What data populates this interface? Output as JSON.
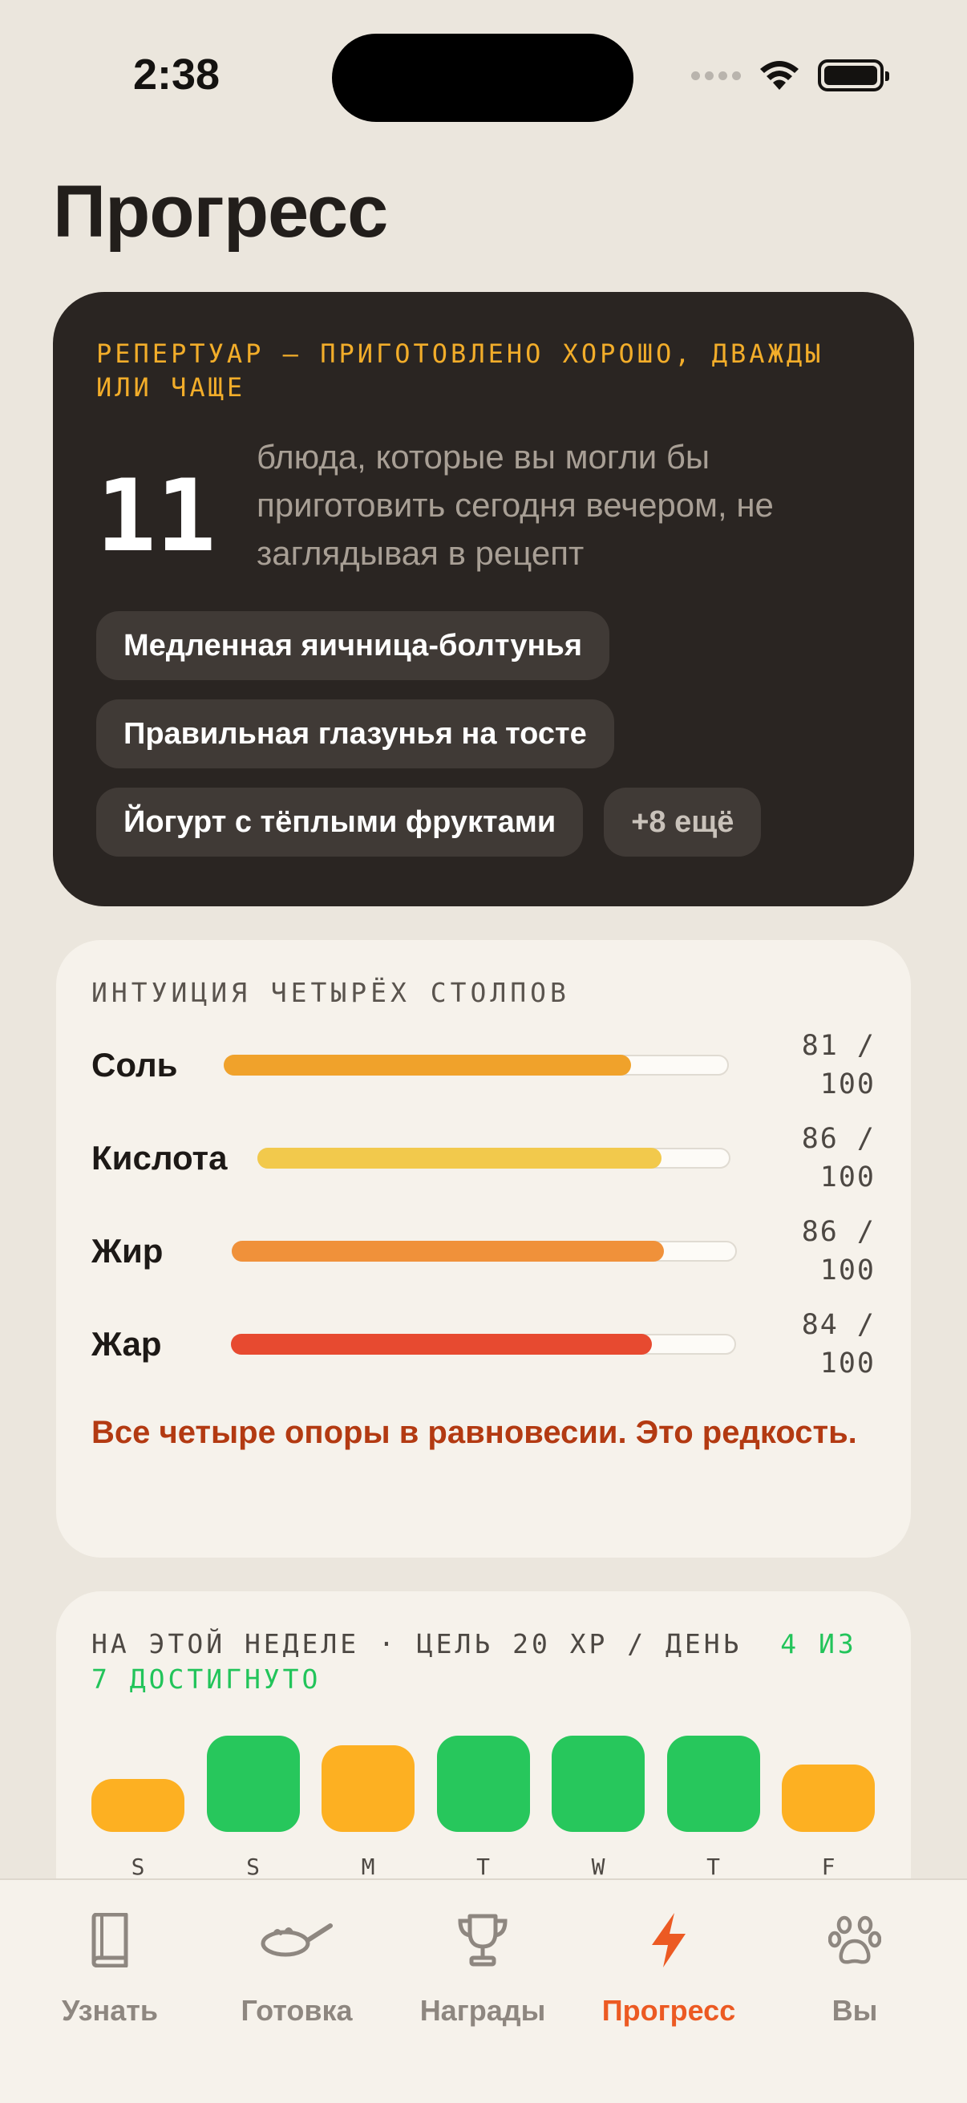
{
  "status_bar": {
    "time": "2:38"
  },
  "header": {
    "title": "Прогресс"
  },
  "repertoire": {
    "label": "РЕПЕРТУАР — ПРИГОТОВЛЕНО ХОРОШО, ДВАЖДЫ ИЛИ ЧАЩЕ",
    "count": "11",
    "description": "блюда, которые вы могли бы приготовить сегодня вечером, не заглядывая в рецепт",
    "dishes": [
      "Медленная яичница-болтунья",
      "Правильная глазунья на тосте",
      "Йогурт с тёплыми фруктами"
    ],
    "more": "+8 ещё"
  },
  "pillars": {
    "label": "ИНТУИЦИЯ ЧЕТЫРЁХ СТОЛПОВ",
    "items": [
      {
        "name": "Соль",
        "score_text": "81 / 100",
        "value": 81,
        "color": "#f0a22b"
      },
      {
        "name": "Кислота",
        "score_text": "86 / 100",
        "value": 86,
        "color": "#f2c94c"
      },
      {
        "name": "Жир",
        "score_text": "86 / 100",
        "value": 86,
        "color": "#f0913a"
      },
      {
        "name": "Жар",
        "score_text": "84 / 100",
        "value": 84,
        "color": "#e74a30"
      }
    ],
    "message": "Все четыре опоры в равновесии. Это редкость."
  },
  "week": {
    "label": "НА ЭТОЙ НЕДЕЛЕ · ЦЕЛЬ 20 XP / ДЕНЬ",
    "goal_status": "4 ИЗ 7 ДОСТИГНУТО",
    "colors": {
      "met": "#27c75c",
      "partial": "#fdb022"
    },
    "days": [
      {
        "letter": "S",
        "level": 0.55,
        "met": false
      },
      {
        "letter": "S",
        "level": 1.0,
        "met": true
      },
      {
        "letter": "M",
        "level": 0.9,
        "met": false
      },
      {
        "letter": "T",
        "level": 1.0,
        "met": true
      },
      {
        "letter": "W",
        "level": 1.0,
        "met": true
      },
      {
        "letter": "T",
        "level": 1.0,
        "met": true
      },
      {
        "letter": "F",
        "level": 0.7,
        "met": false
      }
    ]
  },
  "tabs": [
    {
      "label": "Узнать",
      "icon": "book-icon",
      "active": false
    },
    {
      "label": "Готовка",
      "icon": "pan-icon",
      "active": false
    },
    {
      "label": "Награды",
      "icon": "trophy-icon",
      "active": false
    },
    {
      "label": "Прогресс",
      "icon": "lightning-icon",
      "active": true
    },
    {
      "label": "Вы",
      "icon": "paw-icon",
      "active": false
    }
  ],
  "accent_color": "#ec5a23"
}
